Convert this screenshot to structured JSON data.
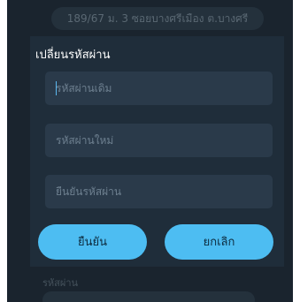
{
  "background": {
    "address_text": "189/67 ม. 3 ซอยบางศรีเมือง ต.บางศรี",
    "password_label": "รหัสผ่าน"
  },
  "dialog": {
    "title": "เปลี่ยนรหัสผ่าน",
    "fields": [
      {
        "placeholder": "รหัสผ่านเดิม",
        "value": ""
      },
      {
        "placeholder": "รหัสผ่านใหม่",
        "value": ""
      },
      {
        "placeholder": "ยืนยันรหัสผ่าน",
        "value": ""
      }
    ],
    "confirm_label": "ยืนยัน",
    "cancel_label": "ยกเลิก"
  },
  "colors": {
    "accent": "#4dbdf2",
    "dialog_bg": "#1f2d3a",
    "field_bg": "#2a3a4a",
    "screen_bg": "#1a242e"
  }
}
